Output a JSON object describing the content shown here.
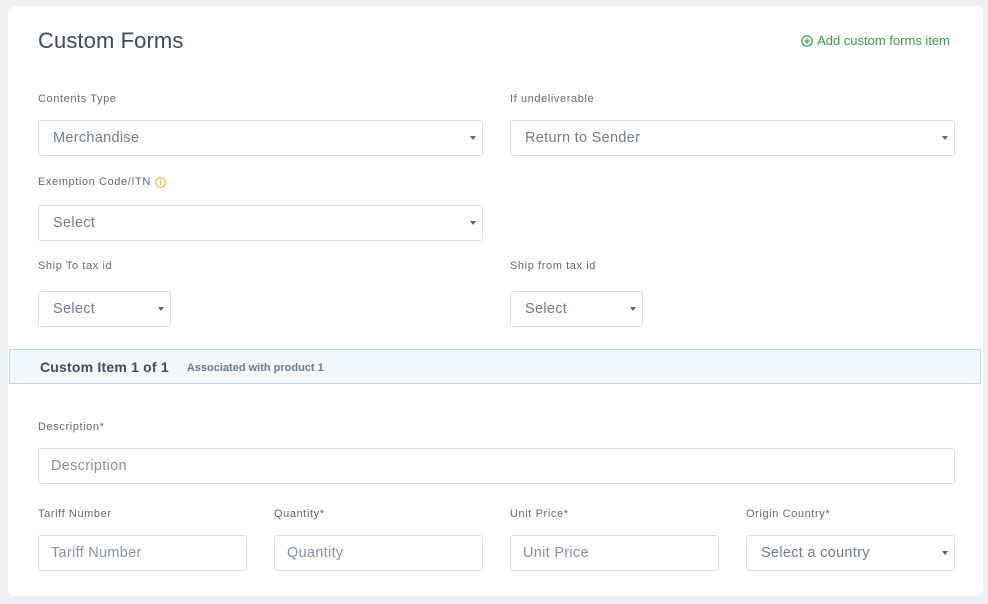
{
  "page_title": "Custom Forms",
  "add_item_link": "Add custom forms item",
  "contents_type": {
    "label": "Contents Type",
    "value": "Merchandise"
  },
  "if_undeliverable": {
    "label": "If undeliverable",
    "value": "Return to Sender"
  },
  "exemption_code": {
    "label": "Exemption Code/ITN",
    "value": "Select"
  },
  "ship_to_tax_id": {
    "label": "Ship To tax id",
    "value": "Select"
  },
  "ship_from_tax_id": {
    "label": "Ship from tax id",
    "value": "Select"
  },
  "custom_item": {
    "title": "Custom Item 1 of 1",
    "subtitle": "Associated with product 1"
  },
  "description": {
    "label": "Description*",
    "placeholder": "Description"
  },
  "tariff_number": {
    "label": "Tariff Number",
    "placeholder": "Tariff Number"
  },
  "quantity": {
    "label": "Quantity*",
    "placeholder": "Quantity"
  },
  "unit_price": {
    "label": "Unit Price*",
    "placeholder": "Unit Price"
  },
  "origin_country": {
    "label": "Origin Country*",
    "value": "Select a country"
  },
  "colors": {
    "accent_green": "#3a9b52",
    "info_icon": "#e8b23a",
    "section_border": "#c2d3ec"
  },
  "icons": {
    "add": "plus-circle-icon",
    "info": "info-circle-icon",
    "dropdown": "caret-down-icon"
  }
}
